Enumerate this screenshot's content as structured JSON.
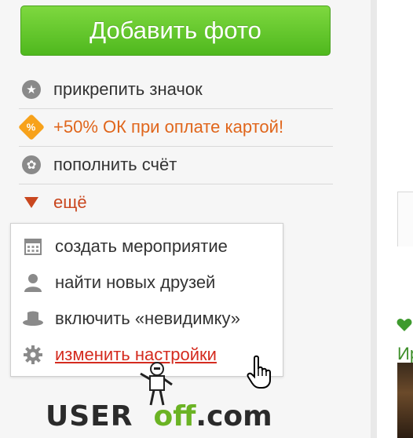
{
  "add_photo_button": "Добавить фото",
  "menu": [
    {
      "label": "прикрепить значок",
      "icon": "star-badge-icon",
      "color": "#333333"
    },
    {
      "label": "+50% ОК при оплате картой!",
      "icon": "ok-percent-icon",
      "color": "#e0661c"
    },
    {
      "label": "пополнить счёт",
      "icon": "ok-coin-icon",
      "color": "#333333"
    },
    {
      "label": "ещё",
      "icon": "triangle-down-icon",
      "color": "#c9471f"
    }
  ],
  "dropdown": [
    {
      "label": "создать мероприятие",
      "icon": "calendar-icon"
    },
    {
      "label": "найти новых друзей",
      "icon": "person-icon"
    },
    {
      "label": "включить «невидимку»",
      "icon": "hat-icon"
    },
    {
      "label": "изменить настройки",
      "icon": "gear-icon",
      "color": "#d42b1f"
    }
  ],
  "watermark": {
    "part1": "USER",
    "part2": "off",
    "part3": ".com"
  },
  "right_text": "Ир",
  "colors": {
    "button_green": "#5cc026",
    "accent_orange": "#e0661c",
    "link_red": "#d42b1f"
  }
}
